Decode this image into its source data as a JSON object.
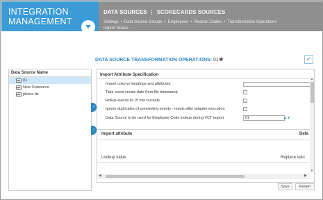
{
  "header": {
    "brand_line1": "INTEGRATION",
    "brand_line2": "MANAGEMENT",
    "tab_active": "DATA SOURCES",
    "tab_separator": "|",
    "tab_inactive": "SCORECARDS SOURCES",
    "breadcrumbs": [
      "Settings",
      "Data Source Groups",
      "Employees",
      "Reason Codes",
      "Transformation Operations",
      "Import Status"
    ]
  },
  "page": {
    "title": "DATA SOURCE TRANSFORMATION OPERATIONS:",
    "title_value": "01",
    "star": "★",
    "check_icon": "✓"
  },
  "left_panel": {
    "header": "Data Source Name",
    "items": [
      "01",
      "New Outsource",
      "phone ds"
    ]
  },
  "main": {
    "section1_title": "Import Attribute Specification",
    "rows": [
      {
        "label": "Import column headings and attributes",
        "control": "text"
      },
      {
        "label": "Take event create date from file timestamp",
        "control": "checkbox"
      },
      {
        "label": "Rollup events to 15 min buckets",
        "control": "checkbox"
      },
      {
        "label": "Ignore duplicates of preexisting events - resets after adapter execution",
        "control": "checkbox"
      },
      {
        "label": "Data Source to be used for Employee Code lookup during VCT import",
        "control": "select",
        "value": "01"
      }
    ],
    "section2_title": "Import attribute",
    "section2_right": "Defa",
    "lookup_label": "Lookup value",
    "replace_label": "Replace valu"
  },
  "buttons": {
    "save": "Save",
    "revert": "Revert"
  },
  "colors": {
    "accent": "#3a9bd7",
    "nav_bg": "#8f8f8f",
    "title": "#2f86c0"
  }
}
